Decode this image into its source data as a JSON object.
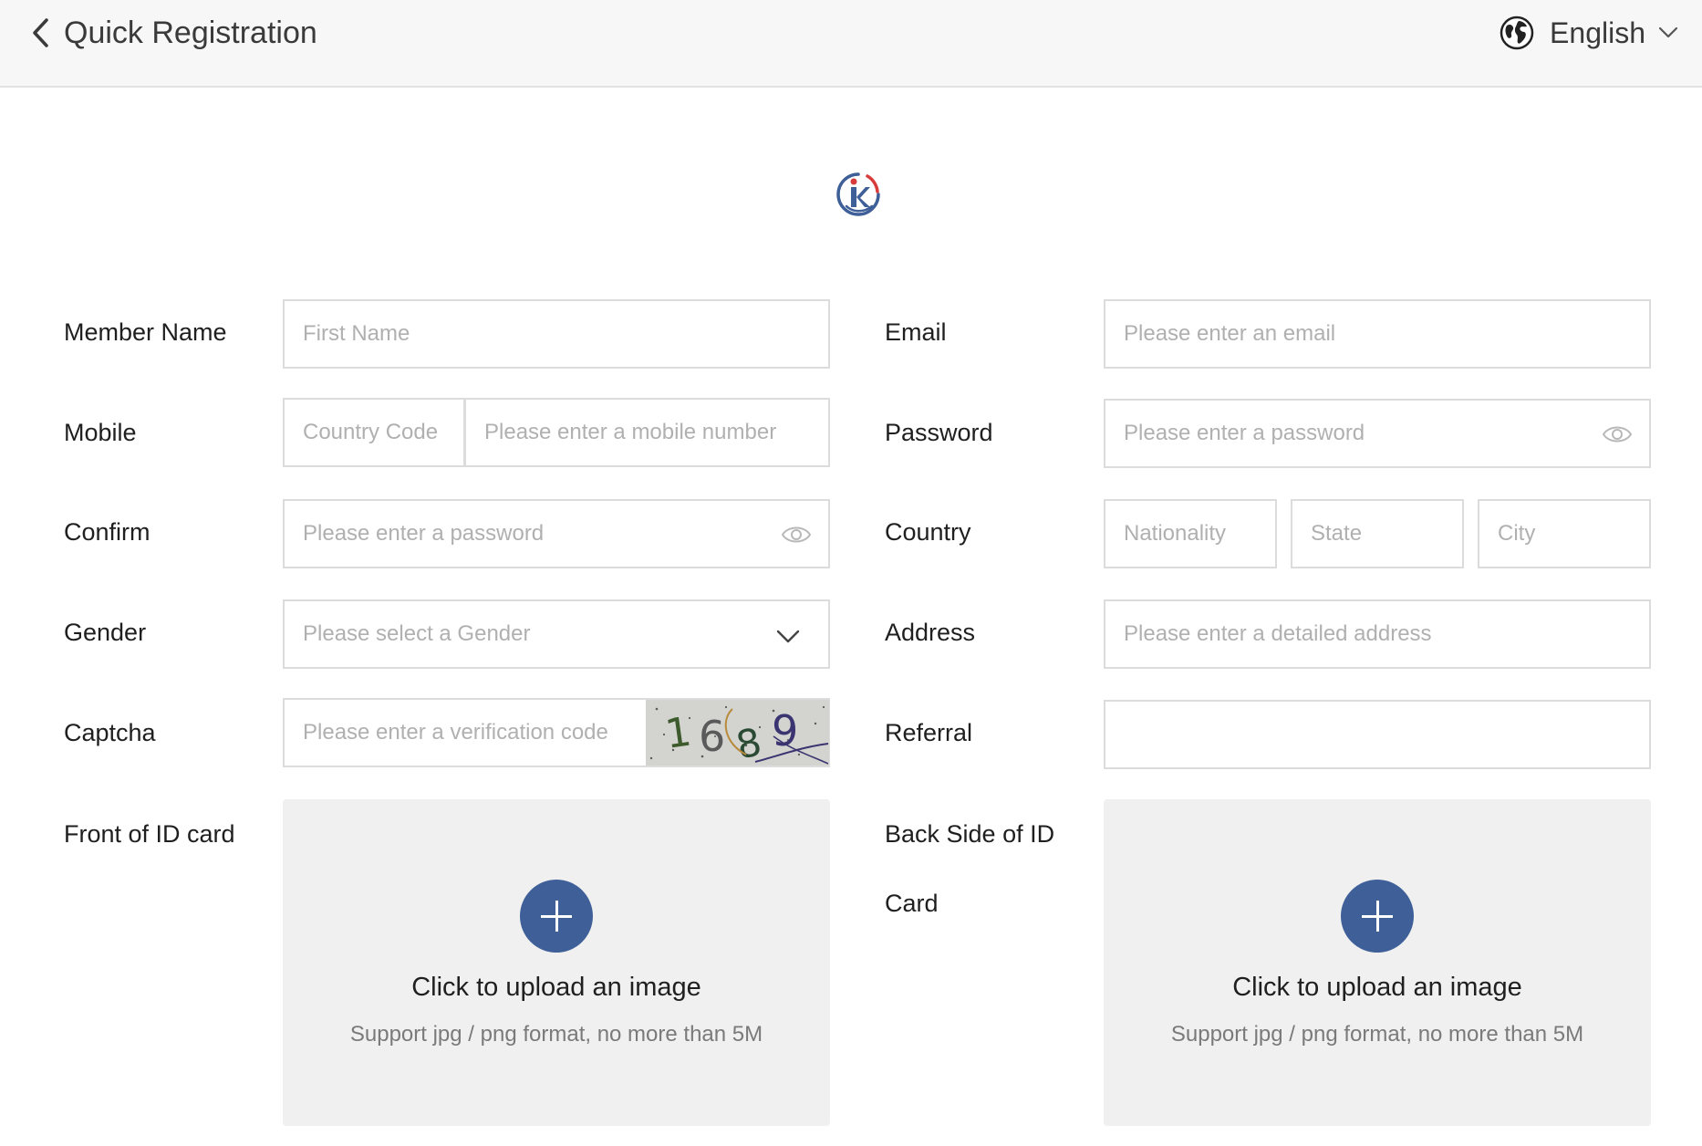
{
  "header": {
    "title": "Quick Registration",
    "language": "English",
    "back_icon": "chevron-left-icon",
    "language_icon": "globe-icon"
  },
  "colors": {
    "accent": "#3f5f98",
    "header_bg": "#f7f7f7",
    "border": "#dcdcdc",
    "placeholder": "#b0b0b0"
  },
  "form": {
    "member_name": {
      "label": "Member Name",
      "placeholder": "First Name",
      "value": ""
    },
    "email": {
      "label": "Email",
      "placeholder": "Please enter an email",
      "value": ""
    },
    "mobile": {
      "label": "Mobile",
      "country_code_placeholder": "Country Code",
      "number_placeholder": "Please enter a mobile number"
    },
    "password": {
      "label": "Password",
      "placeholder": "Please enter a password"
    },
    "confirm": {
      "label": "Confirm",
      "placeholder": "Please enter a password"
    },
    "country": {
      "label": "Country",
      "nationality_placeholder": "Nationality",
      "state_placeholder": "State",
      "city_placeholder": "City"
    },
    "gender": {
      "label": "Gender",
      "placeholder": "Please select a Gender"
    },
    "address": {
      "label": "Address",
      "placeholder": "Please enter a detailed address"
    },
    "captcha": {
      "label": "Captcha",
      "placeholder": "Please enter a verification code",
      "code": "1689"
    },
    "referral": {
      "label": "Referral",
      "value": ""
    },
    "front_id": {
      "label": "Front of ID card",
      "upload_title": "Click to upload an image",
      "upload_hint": "Support jpg / png format, no more than 5M"
    },
    "back_id": {
      "label_line1": "Back Side of ID",
      "label_line2": "Card",
      "upload_title": "Click to upload an image",
      "upload_hint": "Support jpg / png format, no more than 5M"
    }
  }
}
